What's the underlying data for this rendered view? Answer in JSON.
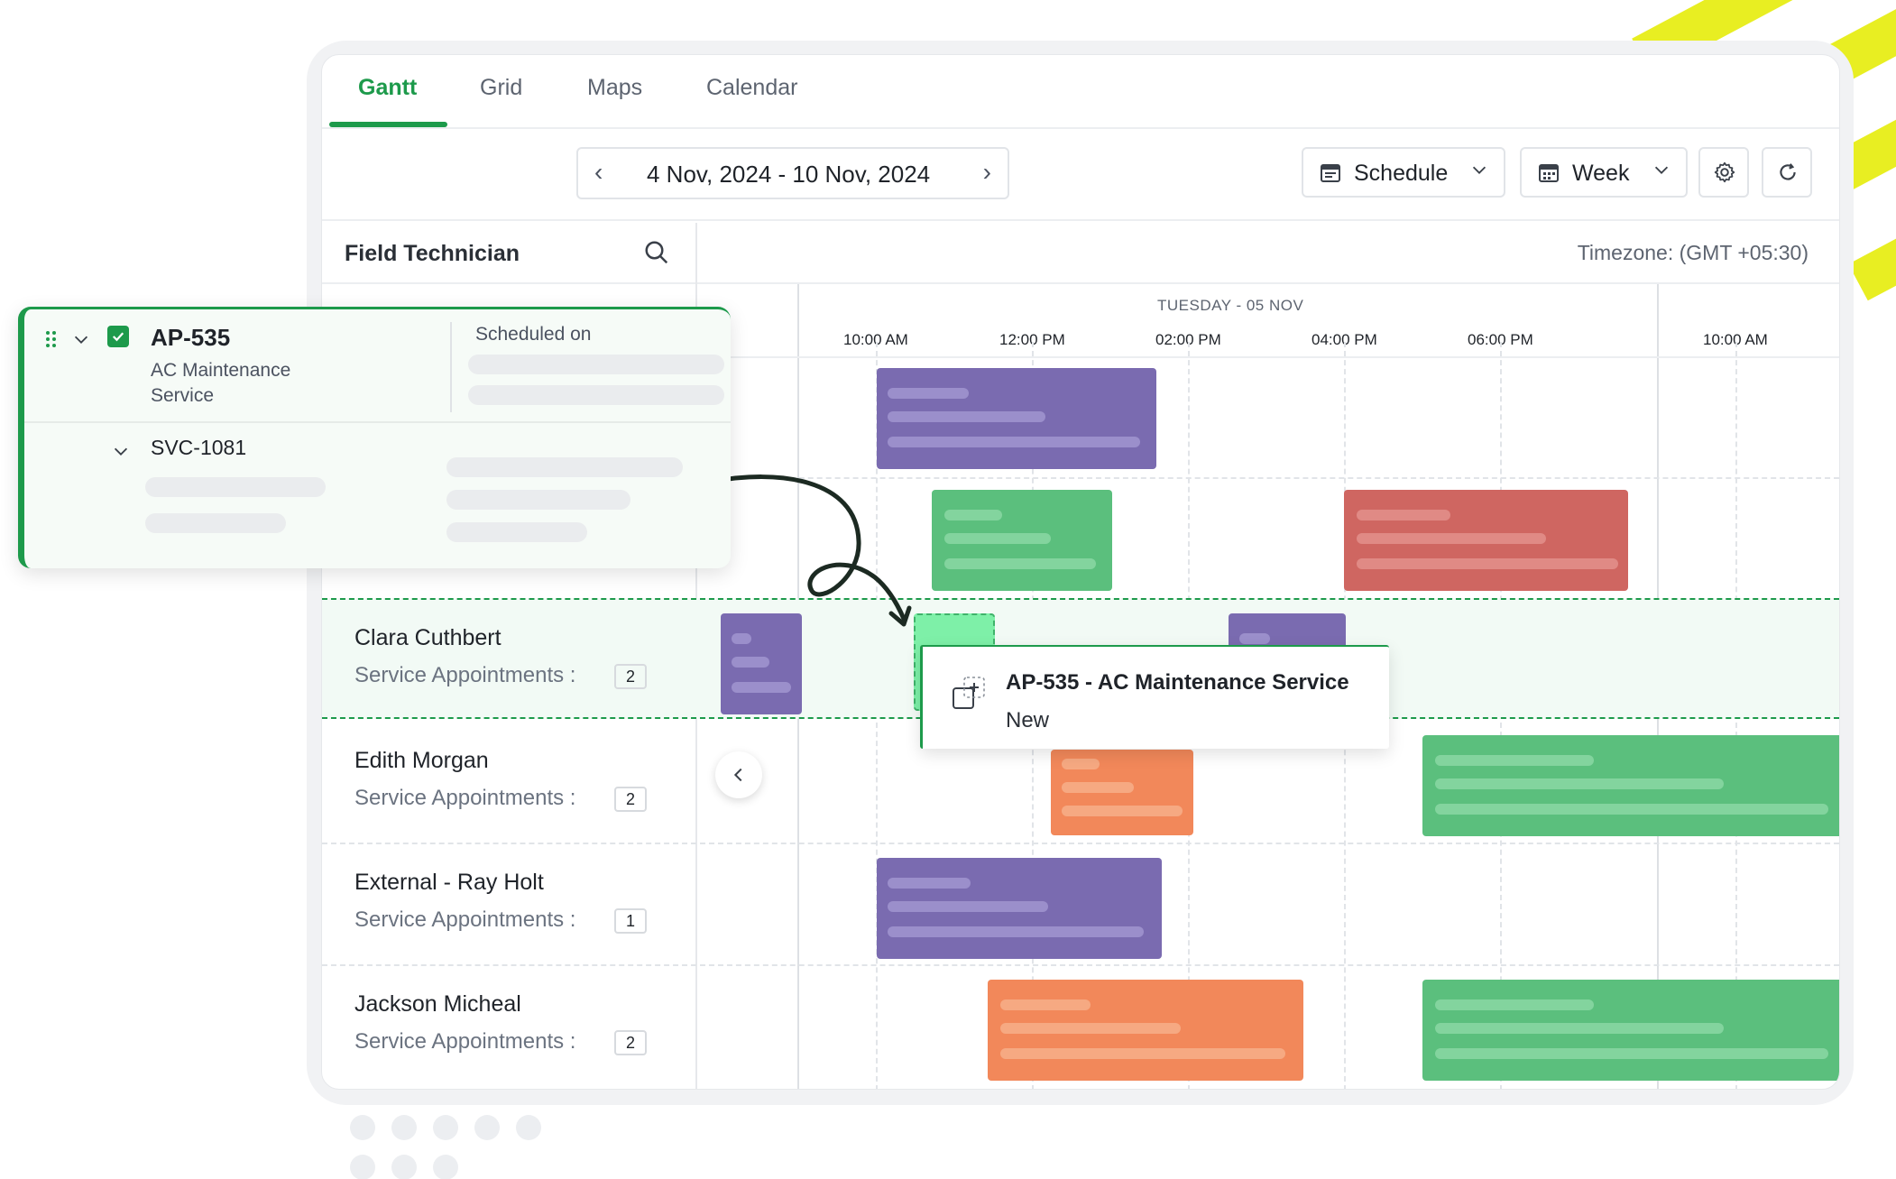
{
  "tabs": [
    {
      "label": "Gantt",
      "active": true
    },
    {
      "label": "Grid",
      "active": false
    },
    {
      "label": "Maps",
      "active": false
    },
    {
      "label": "Calendar",
      "active": false
    }
  ],
  "toolbar": {
    "date_range": "4 Nov, 2024  -  10 Nov, 2024",
    "view_select": "Schedule",
    "period_select": "Week",
    "settings_icon": "gear-icon",
    "refresh_icon": "refresh-icon"
  },
  "column_header": {
    "title": "Field Technician",
    "timezone": "Timezone: (GMT +05:30)"
  },
  "timeline": {
    "day": "TUESDAY - 05 NOV",
    "times": [
      "10:00 AM",
      "12:00 PM",
      "02:00 PM",
      "04:00 PM",
      "06:00 PM",
      "10:00 AM"
    ]
  },
  "technicians": [
    {
      "name": "Clara Cuthbert",
      "label": "Service Appointments :",
      "count": "2"
    },
    {
      "name": "Edith Morgan",
      "label": "Service Appointments :",
      "count": "2"
    },
    {
      "name": "External - Ray Holt",
      "label": "Service Appointments :",
      "count": "1"
    },
    {
      "name": "Jackson Micheal",
      "label": "Service Appointments :",
      "count": "2"
    }
  ],
  "drag_card": {
    "id": "AP-535",
    "service": "AC Maintenance Service",
    "scheduled_label": "Scheduled on",
    "child": "SVC-1081"
  },
  "popup": {
    "title": "AP-535 - AC Maintenance Service",
    "status": "New"
  },
  "colors": {
    "accent": "#1d9a4b",
    "purple": "#7a6bb0",
    "green": "#5bbf7d",
    "red": "#cf6661",
    "orange": "#f2885a",
    "drop_green": "#7ef0a8",
    "stripe": "#e8ee22"
  }
}
